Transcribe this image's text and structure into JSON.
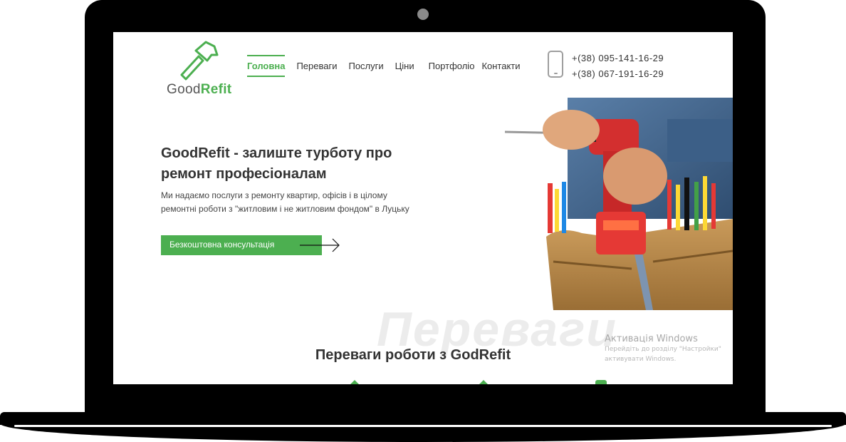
{
  "brand": {
    "name_part1": "Good",
    "name_part2": "Refit",
    "accent_color": "#4caf50"
  },
  "nav": {
    "items": [
      {
        "label": "Головна",
        "active": true
      },
      {
        "label": "Переваги",
        "active": false
      },
      {
        "label": "Послуги",
        "active": false
      },
      {
        "label": "Ціни",
        "active": false
      },
      {
        "label": "Портфоліо",
        "active": false
      },
      {
        "label": "Контакти",
        "active": false
      }
    ]
  },
  "contact": {
    "phone_icon": "phone-icon",
    "phones": [
      "+(38)  095-141-16-29",
      "+(38)  067-191-16-29"
    ]
  },
  "hero": {
    "title": "GoodRefit - залиште турботу про ремонт професіоналам",
    "text": "Ми надаємо послуги з ремонту квартир, офісів і в цілому ремонтні роботи з \"житловим і не житловим фондом\" в Луцьку",
    "cta_label": "Безкоштовна консультація"
  },
  "advantages": {
    "background_word": "Переваги",
    "title": "Переваги роботи з GodRefit"
  },
  "os_watermark": {
    "title": "Активація Windows",
    "line1": "Перейдіть до розділу \"Настройки\"",
    "line2": "активувати Windows."
  }
}
